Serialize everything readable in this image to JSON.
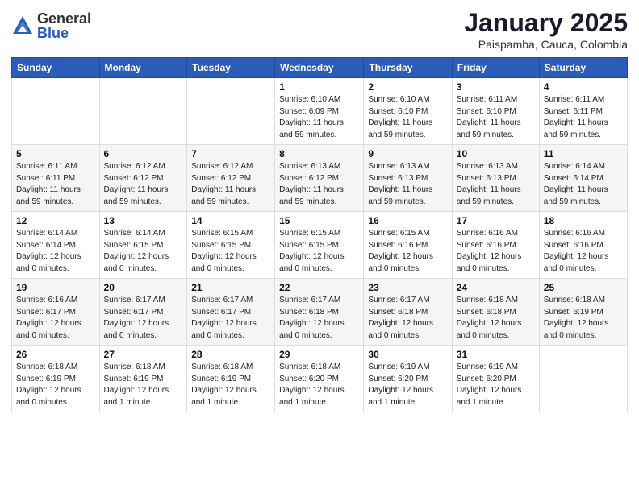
{
  "header": {
    "logo_general": "General",
    "logo_blue": "Blue",
    "title": "January 2025",
    "subtitle": "Paispamba, Cauca, Colombia"
  },
  "days_of_week": [
    "Sunday",
    "Monday",
    "Tuesday",
    "Wednesday",
    "Thursday",
    "Friday",
    "Saturday"
  ],
  "weeks": [
    [
      {
        "day": "",
        "info": ""
      },
      {
        "day": "",
        "info": ""
      },
      {
        "day": "",
        "info": ""
      },
      {
        "day": "1",
        "info": "Sunrise: 6:10 AM\nSunset: 6:09 PM\nDaylight: 11 hours\nand 59 minutes."
      },
      {
        "day": "2",
        "info": "Sunrise: 6:10 AM\nSunset: 6:10 PM\nDaylight: 11 hours\nand 59 minutes."
      },
      {
        "day": "3",
        "info": "Sunrise: 6:11 AM\nSunset: 6:10 PM\nDaylight: 11 hours\nand 59 minutes."
      },
      {
        "day": "4",
        "info": "Sunrise: 6:11 AM\nSunset: 6:11 PM\nDaylight: 11 hours\nand 59 minutes."
      }
    ],
    [
      {
        "day": "5",
        "info": "Sunrise: 6:11 AM\nSunset: 6:11 PM\nDaylight: 11 hours\nand 59 minutes."
      },
      {
        "day": "6",
        "info": "Sunrise: 6:12 AM\nSunset: 6:12 PM\nDaylight: 11 hours\nand 59 minutes."
      },
      {
        "day": "7",
        "info": "Sunrise: 6:12 AM\nSunset: 6:12 PM\nDaylight: 11 hours\nand 59 minutes."
      },
      {
        "day": "8",
        "info": "Sunrise: 6:13 AM\nSunset: 6:12 PM\nDaylight: 11 hours\nand 59 minutes."
      },
      {
        "day": "9",
        "info": "Sunrise: 6:13 AM\nSunset: 6:13 PM\nDaylight: 11 hours\nand 59 minutes."
      },
      {
        "day": "10",
        "info": "Sunrise: 6:13 AM\nSunset: 6:13 PM\nDaylight: 11 hours\nand 59 minutes."
      },
      {
        "day": "11",
        "info": "Sunrise: 6:14 AM\nSunset: 6:14 PM\nDaylight: 11 hours\nand 59 minutes."
      }
    ],
    [
      {
        "day": "12",
        "info": "Sunrise: 6:14 AM\nSunset: 6:14 PM\nDaylight: 12 hours\nand 0 minutes."
      },
      {
        "day": "13",
        "info": "Sunrise: 6:14 AM\nSunset: 6:15 PM\nDaylight: 12 hours\nand 0 minutes."
      },
      {
        "day": "14",
        "info": "Sunrise: 6:15 AM\nSunset: 6:15 PM\nDaylight: 12 hours\nand 0 minutes."
      },
      {
        "day": "15",
        "info": "Sunrise: 6:15 AM\nSunset: 6:15 PM\nDaylight: 12 hours\nand 0 minutes."
      },
      {
        "day": "16",
        "info": "Sunrise: 6:15 AM\nSunset: 6:16 PM\nDaylight: 12 hours\nand 0 minutes."
      },
      {
        "day": "17",
        "info": "Sunrise: 6:16 AM\nSunset: 6:16 PM\nDaylight: 12 hours\nand 0 minutes."
      },
      {
        "day": "18",
        "info": "Sunrise: 6:16 AM\nSunset: 6:16 PM\nDaylight: 12 hours\nand 0 minutes."
      }
    ],
    [
      {
        "day": "19",
        "info": "Sunrise: 6:16 AM\nSunset: 6:17 PM\nDaylight: 12 hours\nand 0 minutes."
      },
      {
        "day": "20",
        "info": "Sunrise: 6:17 AM\nSunset: 6:17 PM\nDaylight: 12 hours\nand 0 minutes."
      },
      {
        "day": "21",
        "info": "Sunrise: 6:17 AM\nSunset: 6:17 PM\nDaylight: 12 hours\nand 0 minutes."
      },
      {
        "day": "22",
        "info": "Sunrise: 6:17 AM\nSunset: 6:18 PM\nDaylight: 12 hours\nand 0 minutes."
      },
      {
        "day": "23",
        "info": "Sunrise: 6:17 AM\nSunset: 6:18 PM\nDaylight: 12 hours\nand 0 minutes."
      },
      {
        "day": "24",
        "info": "Sunrise: 6:18 AM\nSunset: 6:18 PM\nDaylight: 12 hours\nand 0 minutes."
      },
      {
        "day": "25",
        "info": "Sunrise: 6:18 AM\nSunset: 6:19 PM\nDaylight: 12 hours\nand 0 minutes."
      }
    ],
    [
      {
        "day": "26",
        "info": "Sunrise: 6:18 AM\nSunset: 6:19 PM\nDaylight: 12 hours\nand 0 minutes."
      },
      {
        "day": "27",
        "info": "Sunrise: 6:18 AM\nSunset: 6:19 PM\nDaylight: 12 hours\nand 1 minute."
      },
      {
        "day": "28",
        "info": "Sunrise: 6:18 AM\nSunset: 6:19 PM\nDaylight: 12 hours\nand 1 minute."
      },
      {
        "day": "29",
        "info": "Sunrise: 6:18 AM\nSunset: 6:20 PM\nDaylight: 12 hours\nand 1 minute."
      },
      {
        "day": "30",
        "info": "Sunrise: 6:19 AM\nSunset: 6:20 PM\nDaylight: 12 hours\nand 1 minute."
      },
      {
        "day": "31",
        "info": "Sunrise: 6:19 AM\nSunset: 6:20 PM\nDaylight: 12 hours\nand 1 minute."
      },
      {
        "day": "",
        "info": ""
      }
    ]
  ]
}
